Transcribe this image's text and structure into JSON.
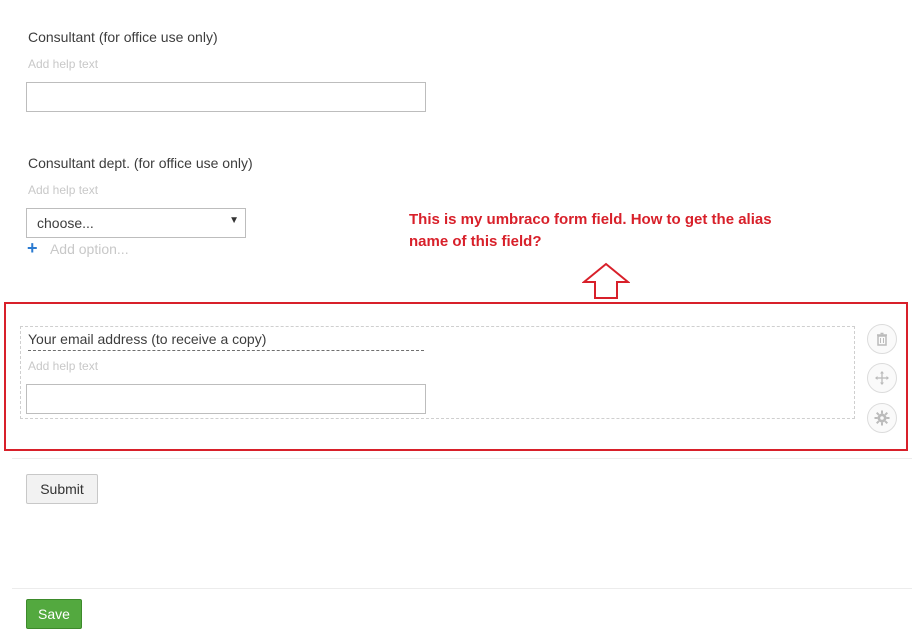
{
  "fields": {
    "consultant": {
      "label": "Consultant (for office use only)",
      "help": "Add help text",
      "value": ""
    },
    "consultant_dept": {
      "label": "Consultant dept. (for office use only)",
      "help": "Add help text",
      "select_value": "choose...",
      "add_option": "Add option..."
    },
    "email": {
      "label": "Your email address (to receive a copy)",
      "help": "Add help text",
      "value": ""
    }
  },
  "annotation": {
    "line1": "This is my umbraco form field. How to get the alias",
    "line2": "name of this field?",
    "color": "#d8202a"
  },
  "buttons": {
    "submit": "Submit",
    "save": "Save"
  },
  "icons": {
    "field_actions": [
      "trash-icon",
      "move-icon",
      "gear-icon"
    ],
    "select_caret": "caret-down-icon",
    "add_option": "plus-icon",
    "annotation_arrow": "up-arrow-icon"
  },
  "colors": {
    "save_button": "#53a93f",
    "add_plus": "#2b7bd1",
    "highlight_frame": "#d8202a"
  }
}
